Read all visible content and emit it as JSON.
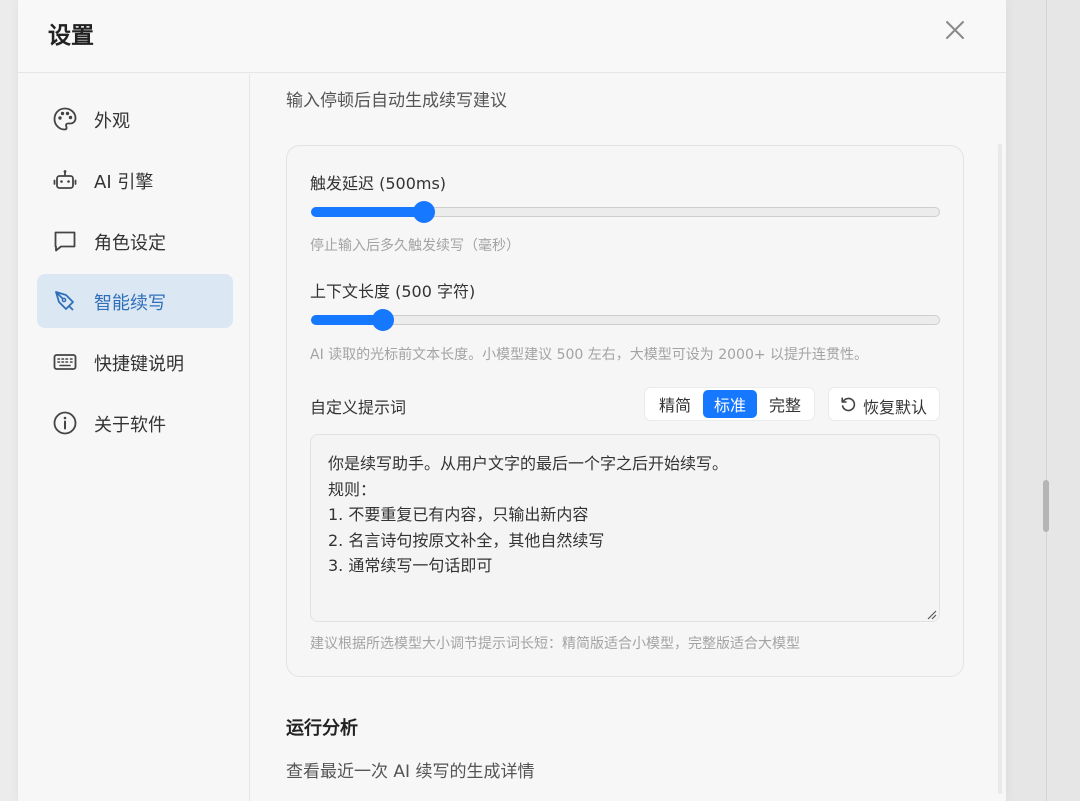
{
  "dialog": {
    "title": "设置",
    "close_icon": "close-icon"
  },
  "sidebar": {
    "items": [
      {
        "label": "外观",
        "icon": "palette-icon",
        "active": false
      },
      {
        "label": "AI 引擎",
        "icon": "robot-icon",
        "active": false
      },
      {
        "label": "角色设定",
        "icon": "chat-bubble-icon",
        "active": false
      },
      {
        "label": "智能续写",
        "icon": "pen-nib-icon",
        "active": true
      },
      {
        "label": "快捷键说明",
        "icon": "keyboard-icon",
        "active": false
      },
      {
        "label": "关于软件",
        "icon": "info-icon",
        "active": false
      }
    ]
  },
  "content": {
    "top_description": "输入停顿后自动生成续写建议",
    "trigger_delay": {
      "label": "触发延迟 (500ms)",
      "hint": "停止输入后多久触发续写（毫秒）",
      "fill_fraction": 0.18
    },
    "context_length": {
      "label": "上下文长度 (500 字符)",
      "hint": "AI 读取的光标前文本长度。小模型建议 500 左右，大模型可设为 2000+ 以提升连贯性。",
      "fill_fraction": 0.115
    },
    "custom_prompt": {
      "label": "自定义提示词",
      "presets": [
        "精简",
        "标准",
        "完整"
      ],
      "active_preset": "标准",
      "reset_label": "恢复默认",
      "text": "你是续写助手。从用户文字的最后一个字之后开始续写。\n规则：\n1. 不要重复已有内容，只输出新内容\n2. 名言诗句按原文补全，其他自然续写\n3. 通常续写一句话即可",
      "hint": "建议根据所选模型大小调节提示词长短：精简版适合小模型，完整版适合大模型"
    },
    "analysis": {
      "title": "运行分析",
      "description": "查看最近一次 AI 续写的生成详情"
    }
  },
  "colors": {
    "accent": "#1677ff",
    "active_nav_bg": "#dbe7f3",
    "active_nav_text": "#2f6fba"
  }
}
